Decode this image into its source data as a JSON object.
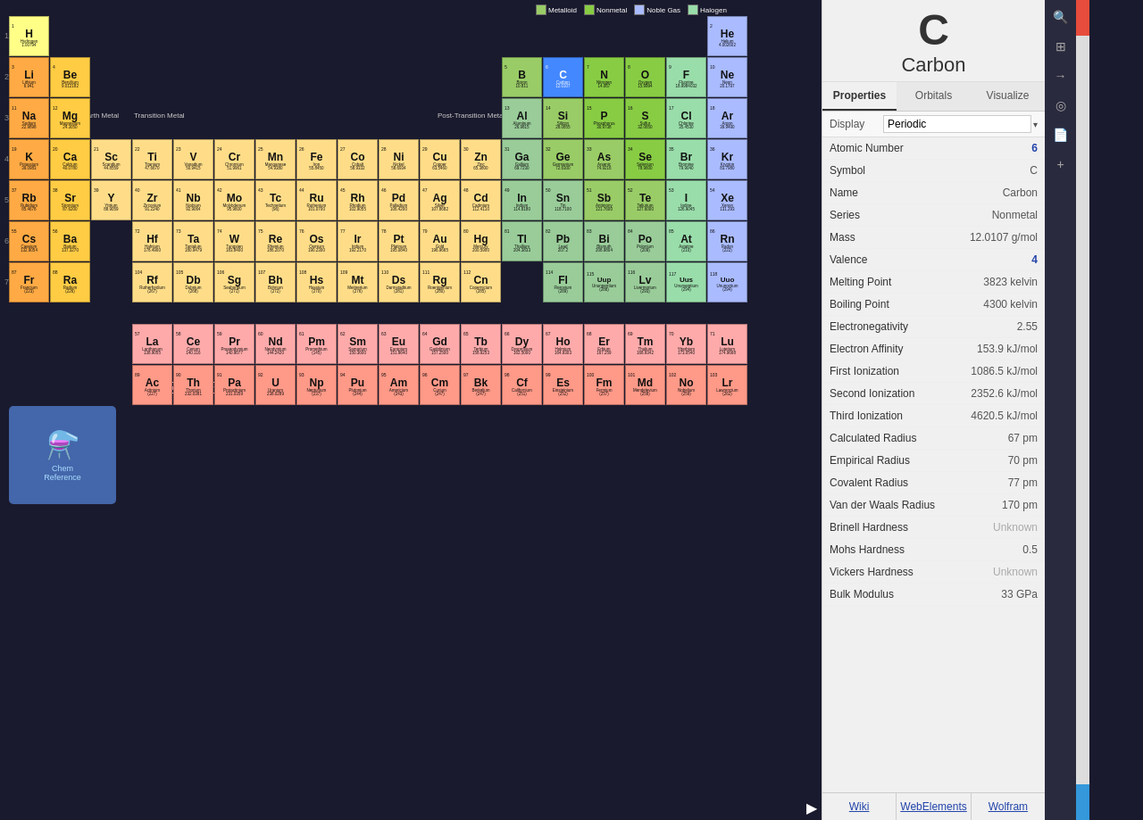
{
  "app": {
    "title": "ChemReference"
  },
  "legend": {
    "metalloid_label": "Metalloid",
    "nonmetal_label": "Nonmetal",
    "noble_gas_label": "Noble Gas",
    "halogen_label": "Halogen"
  },
  "selected_element": {
    "symbol": "C",
    "name": "Carbon",
    "atomic_number": 6,
    "series": "Nonmetal",
    "mass": "12.0107 g/mol",
    "valence": 4,
    "melting_point": "3823 kelvin",
    "boiling_point": "4300 kelvin",
    "electronegativity": "2.55",
    "electron_affinity": "153.9 kJ/mol",
    "first_ionization": "1086.5 kJ/mol",
    "second_ionization": "2352.6 kJ/mol",
    "third_ionization": "4620.5 kJ/mol",
    "calculated_radius": "67 pm",
    "empirical_radius": "70 pm",
    "covalent_radius": "77 pm",
    "vdw_radius": "170 pm",
    "brinell_hardness": "Unknown",
    "mohs_hardness": "0.5",
    "vickers_hardness": "Unknown",
    "bulk_modulus": "33 GPa"
  },
  "tabs": {
    "properties": "Properties",
    "orbitals": "Orbitals",
    "visualize": "Visualize",
    "active": "Properties"
  },
  "display": {
    "label": "Display",
    "value": "Periodic"
  },
  "properties": {
    "atomic_number_label": "Atomic Number",
    "symbol_label": "Symbol",
    "name_label": "Name",
    "series_label": "Series",
    "mass_label": "Mass",
    "valence_label": "Valence",
    "melting_label": "Melting Point",
    "boiling_label": "Boiling Point",
    "electroneg_label": "Electronegativity",
    "electron_affinity_label": "Electron Affinity",
    "first_ion_label": "First Ionization",
    "second_ion_label": "Second Ionization",
    "third_ion_label": "Third Ionization",
    "calc_radius_label": "Calculated Radius",
    "emp_radius_label": "Empirical Radius",
    "cov_radius_label": "Covalent Radius",
    "vdw_radius_label": "Van der Waals Radius",
    "brinell_label": "Brinell Hardness",
    "mohs_label": "Mohs Hardness",
    "vickers_label": "Vickers Hardness",
    "bulk_label": "Bulk Modulus"
  },
  "bottom_links": {
    "wiki": "Wiki",
    "webelements": "WebElements",
    "wolfram": "Wolfram"
  },
  "sidebar_icons": [
    "🔍",
    "⊞",
    "→",
    "◎",
    "📄",
    "+"
  ]
}
